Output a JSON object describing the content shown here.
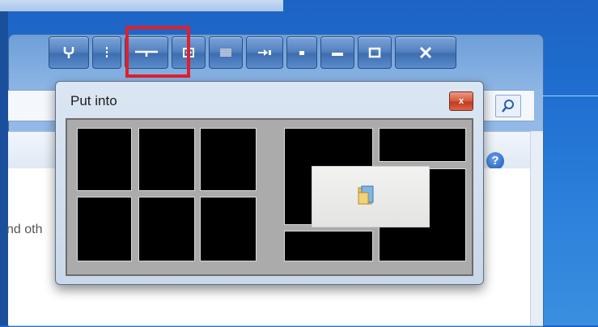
{
  "dialog": {
    "title": "Put into",
    "close_glyph": "x"
  },
  "caption_buttons": [
    {
      "name": "pin-icon",
      "glyph": "Ψ"
    },
    {
      "name": "move-vertical-icon",
      "glyph": "⁝"
    },
    {
      "name": "stretch-horizontal-icon",
      "glyph": "-+-"
    },
    {
      "name": "move-to-monitor-icon",
      "glyph": "⊡"
    },
    {
      "name": "transparency-icon",
      "glyph": "▦"
    },
    {
      "name": "send-to-tray-icon",
      "glyph": "⊳"
    },
    {
      "name": "roll-up-icon",
      "glyph": "▪"
    },
    {
      "name": "minimize-icon",
      "glyph": "▬"
    },
    {
      "name": "maximize-icon",
      "glyph": "□"
    },
    {
      "name": "close-icon",
      "glyph": "X"
    }
  ],
  "background_window": {
    "partial_text": "nd oth",
    "help_glyph": "?"
  },
  "colors": {
    "highlight": "#e0202a",
    "cell": "#000000",
    "grid_bg": "#ababab"
  }
}
